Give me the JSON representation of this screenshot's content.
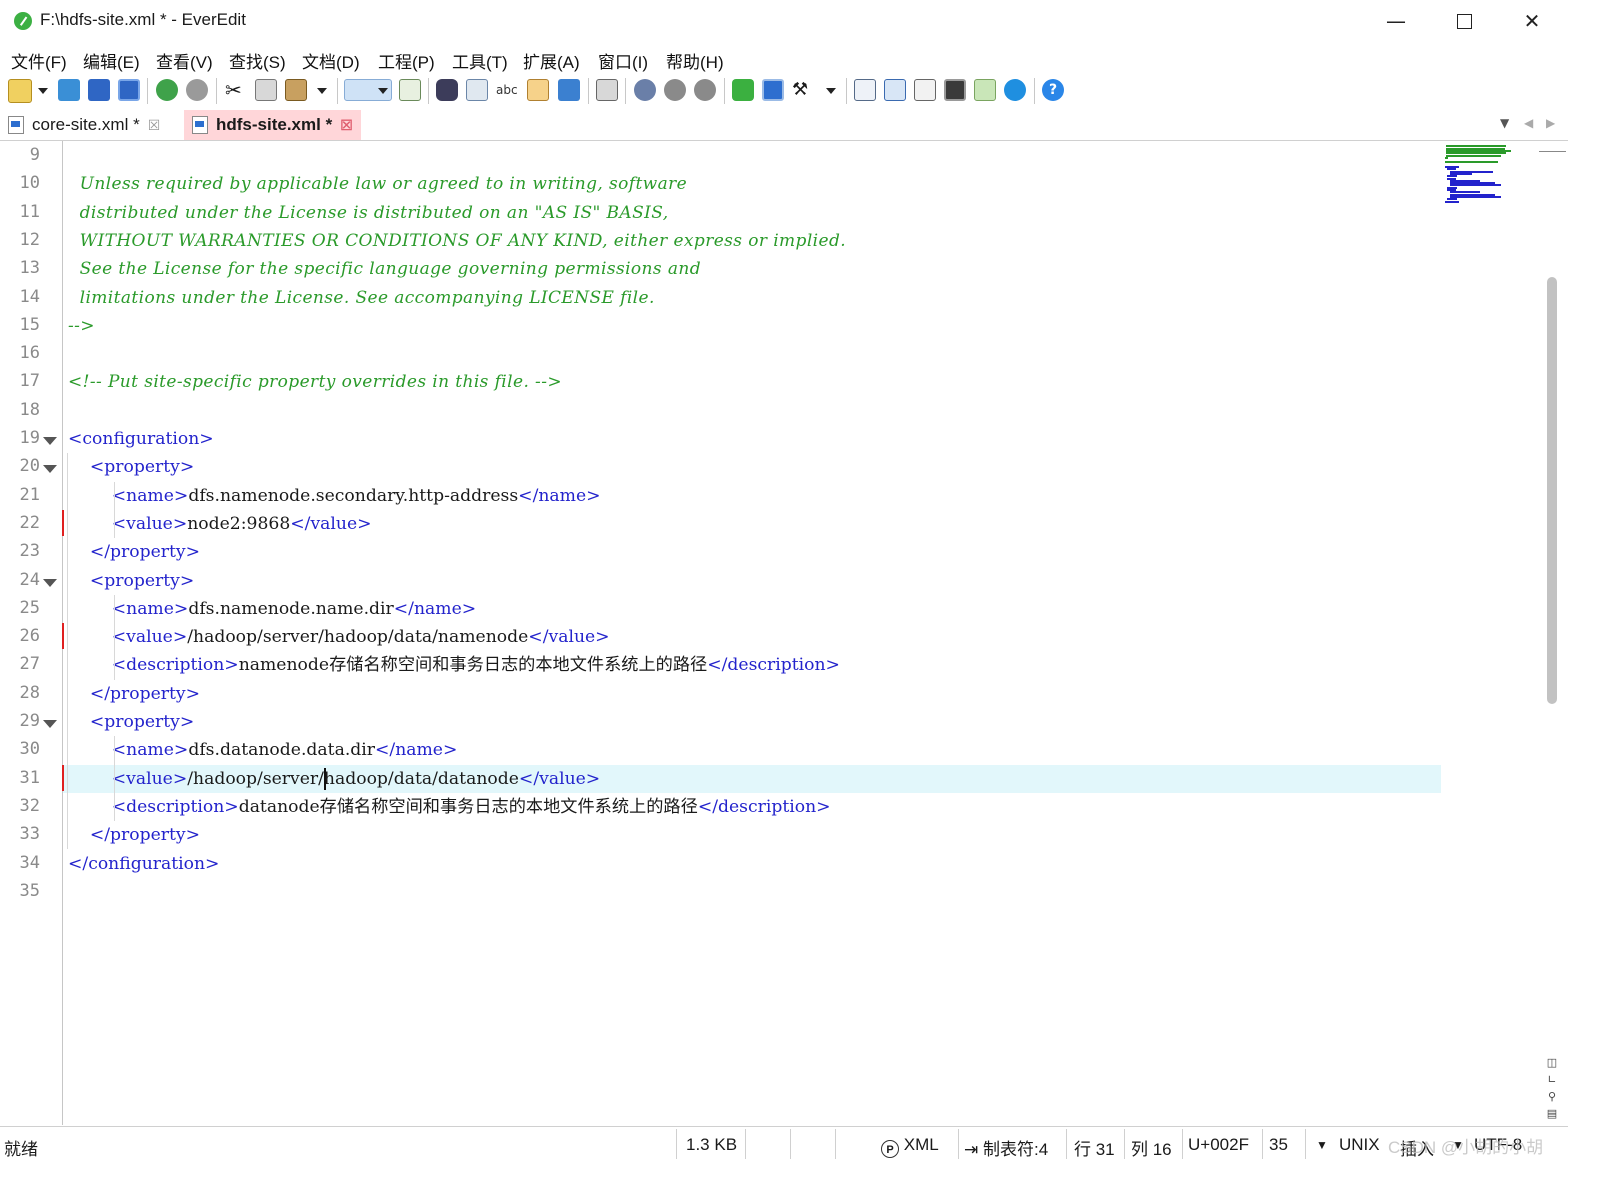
{
  "window": {
    "title": "F:\\hdfs-site.xml * - EverEdit",
    "minimize_icon": "minimize-icon",
    "maximize_icon": "maximize-icon",
    "close_icon": "close-icon"
  },
  "menu": [
    "文件(F)",
    "编辑(E)",
    "查看(V)",
    "查找(S)",
    "文档(D)",
    "工程(P)",
    "工具(T)",
    "扩展(A)",
    "窗口(I)",
    "帮助(H)"
  ],
  "toolbar_icons": [
    "new-file-icon",
    "open-icon",
    "save-icon",
    "save-all-icon",
    "undo-icon",
    "redo-icon",
    "cut-icon",
    "copy-icon",
    "paste-icon",
    "word-wrap-icon",
    "column-mode-icon",
    "find-icon",
    "find-in-files-icon",
    "spell-check-icon",
    "find-file-icon",
    "share-icon",
    "calendar-icon",
    "run-icon",
    "run-2-icon",
    "run-3-icon",
    "plugin-icon",
    "window-icon",
    "tools-icon",
    "outline-icon",
    "layout-icon",
    "clipboard-icon",
    "console-icon",
    "grid-icon",
    "browser-icon",
    "help-icon"
  ],
  "tabs": [
    {
      "label": "core-site.xml *",
      "active": false
    },
    {
      "label": "hdfs-site.xml *",
      "active": true
    }
  ],
  "editor": {
    "first_line": 9,
    "current_line": 31,
    "lines": [
      {
        "n": "9",
        "text": ""
      },
      {
        "n": "10",
        "text": "  Unless required by applicable law or agreed to in writing, software"
      },
      {
        "n": "11",
        "text": "  distributed under the License is distributed on an \"AS IS\" BASIS,"
      },
      {
        "n": "12",
        "text": "  WITHOUT WARRANTIES OR CONDITIONS OF ANY KIND, either express or implied."
      },
      {
        "n": "13",
        "text": "  See the License for the specific language governing permissions and"
      },
      {
        "n": "14",
        "text": "  limitations under the License. See accompanying LICENSE file."
      },
      {
        "n": "15",
        "text": "-->"
      },
      {
        "n": "16",
        "text": ""
      },
      {
        "n": "17",
        "text": "<!-- Put site-specific property overrides in this file. -->"
      },
      {
        "n": "18",
        "text": ""
      },
      {
        "n": "19",
        "text": "<configuration>"
      },
      {
        "n": "20",
        "text": "    <property>"
      },
      {
        "n": "21",
        "text": "        <name>dfs.namenode.secondary.http-address</name>"
      },
      {
        "n": "22",
        "text": "        <value>node2:9868</value>"
      },
      {
        "n": "23",
        "text": "    </property>"
      },
      {
        "n": "24",
        "text": "    <property>"
      },
      {
        "n": "25",
        "text": "        <name>dfs.namenode.name.dir</name>"
      },
      {
        "n": "26",
        "text": "        <value>/hadoop/server/hadoop/data/namenode</value>"
      },
      {
        "n": "27",
        "text": "        <description>namenode存储名称空间和事务日志的本地文件系统上的路径</description>"
      },
      {
        "n": "28",
        "text": "    </property>"
      },
      {
        "n": "29",
        "text": "    <property>"
      },
      {
        "n": "30",
        "text": "        <name>dfs.datanode.data.dir</name>"
      },
      {
        "n": "31",
        "text": "        <value>/hadoop/server/hadoop/data/datanode</value>"
      },
      {
        "n": "32",
        "text": "        <description>datanode存储名称空间和事务日志的本地文件系统上的路径</description>"
      },
      {
        "n": "33",
        "text": "    </property>"
      },
      {
        "n": "34",
        "text": "</configuration>"
      },
      {
        "n": "35",
        "text": ""
      }
    ]
  },
  "status": {
    "ready": "就绪",
    "size": "1.3 KB",
    "language": "XML",
    "tab_setting": "制表符:4",
    "line": "行 31",
    "column": "列 16",
    "char": "U+002F",
    "char_dec": "35",
    "eol": "UNIX",
    "mode": "插入",
    "encoding": "UTF-8",
    "watermark": "CSDN @小胡的小胡"
  },
  "colors": {
    "comment": "#2a9a2a",
    "tag": "#2323cc",
    "text": "#1a1a1a",
    "current_line": "#e2f7fb",
    "active_tab": "#ffd6d9",
    "modified_marker": "#e02020"
  }
}
